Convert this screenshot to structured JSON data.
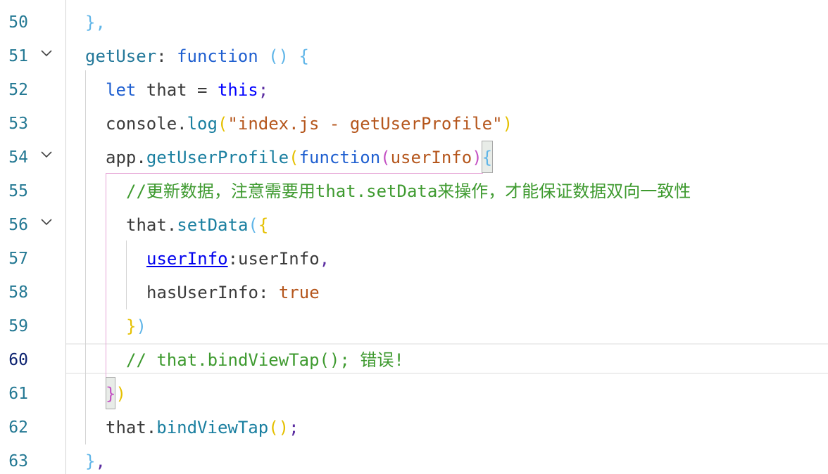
{
  "editor": {
    "current_line": "60",
    "lines": [
      {
        "number": "50",
        "fold": false,
        "segments": [
          [
            "blu",
            "},"
          ]
        ]
      },
      {
        "number": "51",
        "fold": true,
        "segments": [
          [
            "tid",
            "getUser"
          ],
          [
            "v",
            ": "
          ],
          [
            "kwd",
            "function"
          ],
          [
            "v",
            " "
          ],
          [
            "blu",
            "()"
          ],
          [
            "v",
            " "
          ],
          [
            "blu",
            "{"
          ]
        ]
      },
      {
        "number": "52",
        "fold": false,
        "segments": [
          [
            "kwd",
            "let"
          ],
          [
            "v",
            " that = "
          ],
          [
            "thiskw",
            "this"
          ],
          [
            "puncth",
            ";"
          ]
        ]
      },
      {
        "number": "53",
        "fold": false,
        "segments": [
          [
            "v",
            "console"
          ],
          [
            "v",
            "."
          ],
          [
            "meth",
            "log"
          ],
          [
            "yel",
            "("
          ],
          [
            "orange",
            "\"index.js - getUserProfile\""
          ],
          [
            "yel",
            ")"
          ]
        ]
      },
      {
        "number": "54",
        "fold": true,
        "segments": [
          [
            "v",
            "app"
          ],
          [
            "v",
            "."
          ],
          [
            "meth",
            "getUserProfile"
          ],
          [
            "yel",
            "("
          ],
          [
            "kwd",
            "function"
          ],
          [
            "mag",
            "("
          ],
          [
            "orange",
            "userInfo"
          ],
          [
            "mag",
            ")"
          ],
          [
            "blu",
            "{"
          ]
        ]
      },
      {
        "number": "55",
        "fold": false,
        "segments": [
          [
            "comment",
            "//更新数据，注意需要用that.setData来操作，才能保证数据双向一致性"
          ]
        ]
      },
      {
        "number": "56",
        "fold": true,
        "segments": [
          [
            "v",
            "that"
          ],
          [
            "v",
            "."
          ],
          [
            "meth",
            "setData"
          ],
          [
            "blu",
            "("
          ],
          [
            "yel",
            "{"
          ]
        ]
      },
      {
        "number": "57",
        "fold": false,
        "segments": [
          [
            "link",
            "userInfo"
          ],
          [
            "v",
            ":userInfo"
          ],
          [
            "puncth",
            ","
          ]
        ]
      },
      {
        "number": "58",
        "fold": false,
        "segments": [
          [
            "v",
            "hasUserInfo"
          ],
          [
            "v",
            ": "
          ],
          [
            "orange",
            "true"
          ]
        ]
      },
      {
        "number": "59",
        "fold": false,
        "segments": [
          [
            "yel",
            "}"
          ],
          [
            "blu",
            ")"
          ]
        ]
      },
      {
        "number": "60",
        "fold": false,
        "segments": [
          [
            "comment",
            "// that.bindViewTap(); 错误!"
          ]
        ]
      },
      {
        "number": "61",
        "fold": false,
        "segments": [
          [
            "mag",
            "}"
          ],
          [
            "yel",
            ")"
          ]
        ]
      },
      {
        "number": "62",
        "fold": false,
        "segments": [
          [
            "v",
            "that"
          ],
          [
            "v",
            "."
          ],
          [
            "meth",
            "bindViewTap"
          ],
          [
            "yel",
            "()"
          ],
          [
            "puncth",
            ";"
          ]
        ]
      },
      {
        "number": "63",
        "fold": false,
        "segments": [
          [
            "blu",
            "}"
          ],
          [
            "puncth",
            ","
          ]
        ]
      }
    ]
  },
  "colors": {
    "line_number": "#237893",
    "line_number_active": "#0b216f",
    "comment": "#3e9a2f",
    "keyword": "#1f5fd0",
    "method": "#1a7fa0",
    "string": "#b5561c",
    "bracket_pair_guide": "#e6a4d6"
  }
}
